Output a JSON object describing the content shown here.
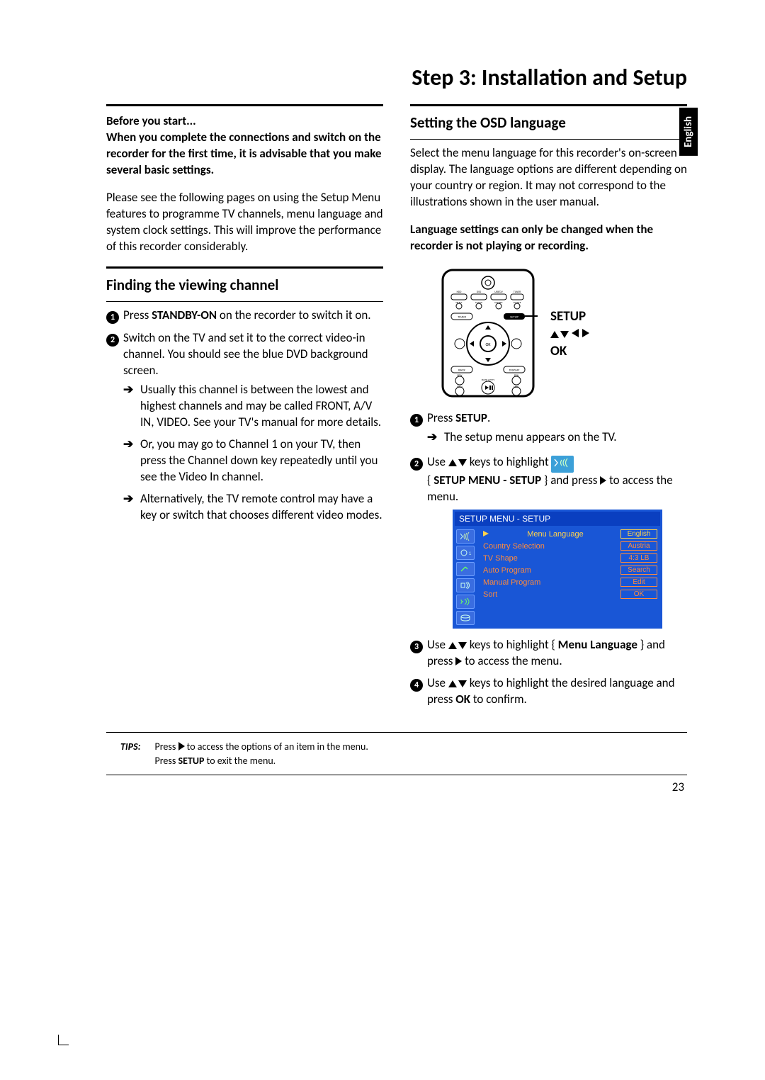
{
  "page_title": "Step 3: Installation and Setup",
  "language_tab": "English",
  "page_number": "23",
  "left": {
    "intro_heading_1": "Before you start...",
    "intro_heading_2": "When you complete the connections and switch on the recorder for the first time, it is advisable that you make several basic settings.",
    "intro_para": "Please see the following pages on using the Setup Menu features to programme TV channels, menu language and system clock settings. This will improve the performance of this recorder considerably.",
    "section_title": "Finding the viewing channel",
    "steps": {
      "s1_pre": "Press ",
      "s1_bold": "STANDBY-ON",
      "s1_post": " on the recorder to switch it on.",
      "s2": "Switch on the TV and set it to the correct video-in channel. You should see the blue DVD background screen.",
      "s2a": "Usually this channel is between the lowest and highest channels and may be called FRONT, A/V IN, VIDEO. See your TV's manual for more details.",
      "s2b": "Or, you may go to Channel 1 on your TV, then press the Channel down key repeatedly until you see the Video In channel.",
      "s2c": "Alternatively, the TV remote control may have a key or switch that chooses different video modes."
    }
  },
  "right": {
    "section_title": "Setting the OSD language",
    "intro": "Select the menu language for this recorder's on-screen display.  The language options are different depending on your country or region.  It may not correspond to the illustrations shown in the user manual.",
    "bold_note": "Language settings can only be changed when the recorder is not playing or recording.",
    "remote_labels": {
      "setup": "SETUP",
      "ok": "OK"
    },
    "remote_buttons": {
      "timer": "TIMER",
      "setup_btn": "SETUP",
      "back": "BACK",
      "display": "DISPLAY",
      "ok_btn": "OK",
      "rew": "REW",
      "ffw": "FFW",
      "prev": "PREV",
      "next": "NEXT",
      "pause": "PAUSE LIVE TV",
      "hdd": "HDD",
      "dvd": "DVD",
      "usbdv": "USB/DV",
      "tuner": "TUNER",
      "select": "SELECT",
      "tvdvd": "TV/DVD",
      "dvdrec": "DVD REC",
      "source": "SOURCE"
    },
    "steps": {
      "s1_pre": "Press ",
      "s1_bold": "SETUP",
      "s1_post": ".",
      "s1a": "The setup menu appears on the TV.",
      "s2_pre": "Use ",
      "s2_mid": " keys to highlight ",
      "s2_brace_pre": "{ ",
      "s2_brace_bold": "SETUP MENU - SETUP",
      "s2_brace_post": " } and press ",
      "s2_end": " to access the menu.",
      "s3_pre": "Use ",
      "s3_mid": " keys to highlight { ",
      "s3_bold": "Menu Language",
      "s3_post": " } and press ",
      "s3_end": " to access the menu.",
      "s4_pre": "Use ",
      "s4_mid": " keys to highlight the desired language and press ",
      "s4_bold": "OK",
      "s4_post": " to confirm."
    },
    "osd": {
      "title": "SETUP MENU - SETUP",
      "rows": [
        {
          "label": "Menu Language",
          "value": "English",
          "highlight": true
        },
        {
          "label": "Country Selection",
          "value": "Austria"
        },
        {
          "label": "TV Shape",
          "value": "4:3 LB"
        },
        {
          "label": "Auto Program",
          "value": "Search"
        },
        {
          "label": "Manual Program",
          "value": "Edit"
        },
        {
          "label": "Sort",
          "value": "OK"
        }
      ]
    }
  },
  "tips": {
    "label": "TIPS:",
    "line1_pre": "Press ",
    "line1_post": " to access the options of an item in the menu.",
    "line2_pre": "Press ",
    "line2_bold": "SETUP",
    "line2_post": " to exit the menu."
  }
}
